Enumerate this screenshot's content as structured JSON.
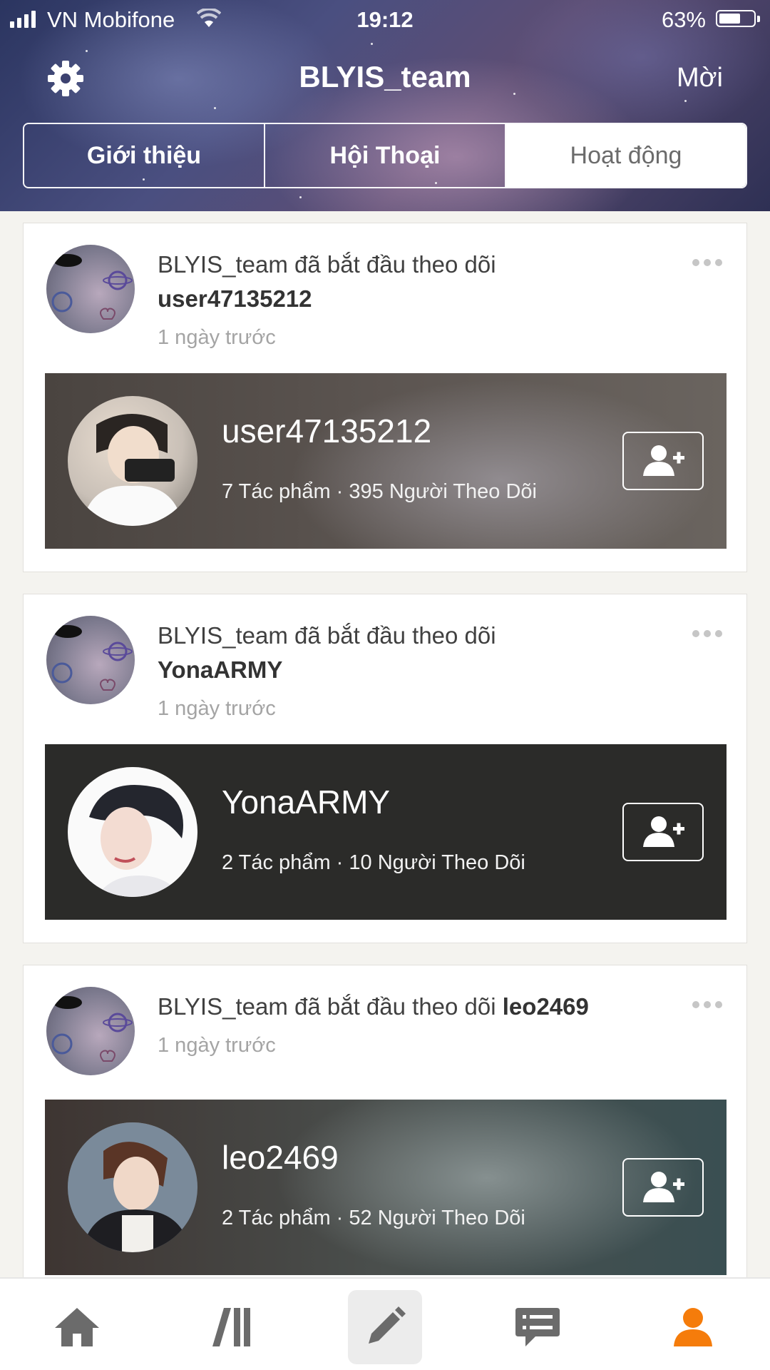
{
  "status_bar": {
    "carrier": "VN Mobifone",
    "time": "19:12",
    "battery": "63%",
    "battery_level": 0.63
  },
  "header": {
    "title": "BLYIS_team",
    "invite_label": "Mời",
    "settings_icon": "gear-icon"
  },
  "tabs": [
    {
      "label": "Giới thiệu",
      "active": false
    },
    {
      "label": "Hội Thoại",
      "active": false
    },
    {
      "label": "Hoạt động",
      "active": true
    }
  ],
  "feed": [
    {
      "actor": "BLYIS_team",
      "action": "đã bắt đầu theo dõi",
      "target": "user47135212",
      "time": "1 ngày trước",
      "user": {
        "name": "user47135212",
        "stats": "7 Tác phẩm · 395 Người Theo Dõi"
      }
    },
    {
      "actor": "BLYIS_team",
      "action": "đã bắt đầu theo dõi",
      "target": "YonaARMY",
      "time": "1 ngày trước",
      "user": {
        "name": "YonaARMY",
        "stats": "2 Tác phẩm · 10 Người Theo Dõi"
      }
    },
    {
      "actor": "BLYIS_team",
      "action": "đã bắt đầu theo dõi",
      "target": "leo2469",
      "time": "1 ngày trước",
      "user": {
        "name": "leo2469",
        "stats": "2 Tác phẩm · 52 Người Theo Dõi"
      }
    }
  ],
  "bottom_nav": [
    {
      "icon": "home-icon",
      "active": false
    },
    {
      "icon": "library-icon",
      "active": false
    },
    {
      "icon": "write-pencil-icon",
      "active": false
    },
    {
      "icon": "messages-icon",
      "active": false
    },
    {
      "icon": "profile-icon",
      "active": true
    }
  ],
  "colors": {
    "accent": "#f57c0b",
    "nav_inactive": "#6b6b6b",
    "timestamp": "#a4a4a4"
  }
}
